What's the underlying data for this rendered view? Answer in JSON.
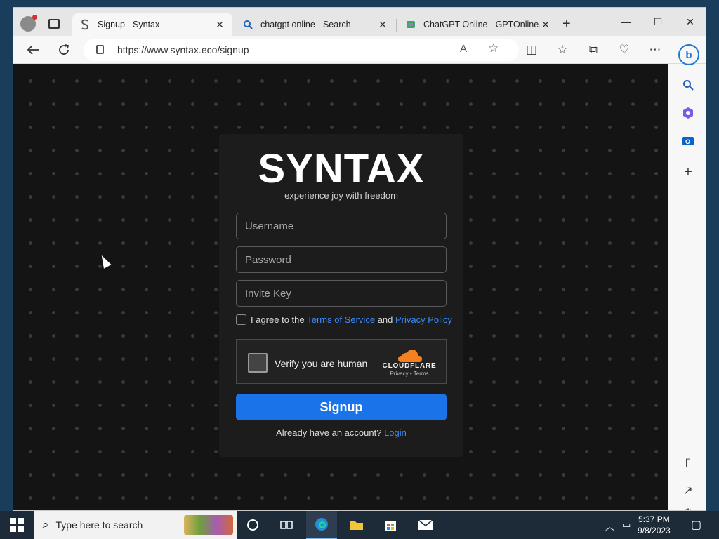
{
  "browser": {
    "tabs": [
      {
        "title": "Signup - Syntax",
        "favicon": "syntax-s-icon",
        "active": true
      },
      {
        "title": "chatgpt online - Search",
        "favicon": "search-icon",
        "active": false
      },
      {
        "title": "ChatGPT Online - GPTOnline.ai",
        "favicon": "gptonline-icon",
        "active": false
      }
    ],
    "url": "https://www.syntax.eco/signup"
  },
  "page": {
    "brand": "SYNTAX",
    "tagline": "experience joy with freedom",
    "username_placeholder": "Username",
    "password_placeholder": "Password",
    "invite_placeholder": "Invite Key",
    "agree_prefix": "I agree to the",
    "terms_link": "Terms of Service",
    "agree_and": "and",
    "privacy_link": "Privacy Policy",
    "captcha": {
      "label": "Verify you are human",
      "provider": "CLOUDFLARE",
      "links": "Privacy • Terms"
    },
    "submit_label": "Signup",
    "login_prompt": "Already have an account?",
    "login_link": "Login"
  },
  "taskbar": {
    "search_placeholder": "Type here to search",
    "time": "5:37 PM",
    "date": "9/8/2023"
  },
  "colors": {
    "accent": "#1a73e8",
    "link": "#3b8cff",
    "page_bg": "#141414",
    "card_bg": "#1c1c1c",
    "cloudflare": "#f48120"
  }
}
